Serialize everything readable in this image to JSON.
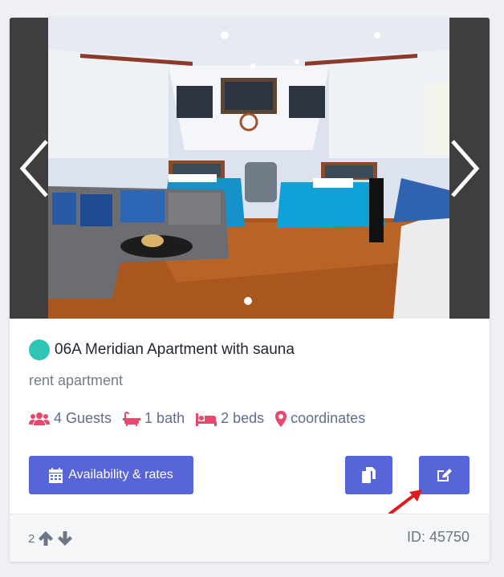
{
  "listing": {
    "title": "06A Meridian Apartment with sauna",
    "type": "rent apartment",
    "status_color": "#2ec4b6",
    "gallery": {
      "image_count": 1,
      "active_index": 0
    },
    "amenities": {
      "guests": "4 Guests",
      "bath": "1 bath",
      "beds": "2 beds",
      "location": "coordinates"
    },
    "actions": {
      "availability_label": "Availability & rates",
      "copy_icon": "copy-icon",
      "edit_icon": "edit-icon"
    },
    "footer": {
      "vote_count": "2",
      "id_label": "ID: 45750"
    }
  },
  "colors": {
    "primary": "#5865d8",
    "amenity_icon": "#e8486e",
    "amenity_text": "#5f6d8f",
    "annotation_arrow": "#e01b1b"
  }
}
